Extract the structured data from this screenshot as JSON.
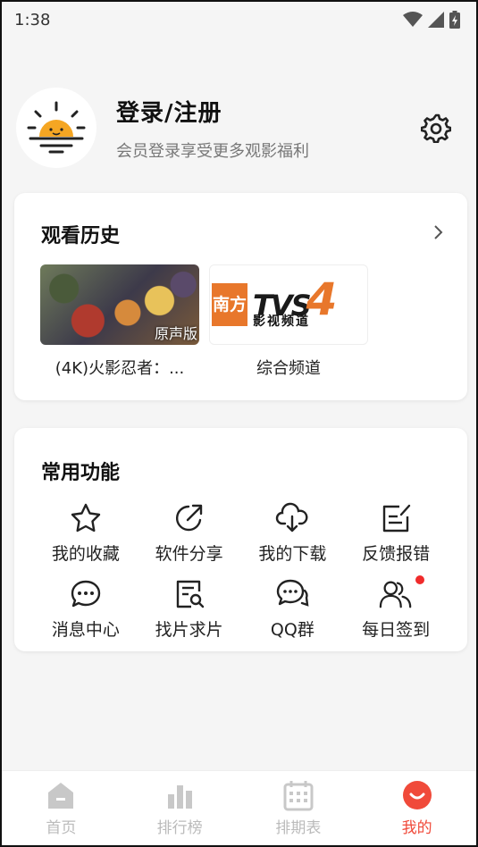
{
  "status_bar": {
    "time": "1:38"
  },
  "profile": {
    "title": "登录/注册",
    "subtitle": "会员登录享受更多观影福利"
  },
  "history": {
    "title": "观看历史",
    "items": [
      {
        "caption": "(4K)火影忍者：...",
        "badge": "原声版"
      },
      {
        "caption": "综合频道",
        "logo_box": "南方",
        "logo_letters": "TVS",
        "logo_num": "4",
        "logo_sub": "影视频道"
      }
    ]
  },
  "features": {
    "title": "常用功能",
    "items": [
      {
        "label": "我的收藏",
        "icon": "star-icon"
      },
      {
        "label": "软件分享",
        "icon": "share-icon"
      },
      {
        "label": "我的下载",
        "icon": "cloud-download-icon"
      },
      {
        "label": "反馈报错",
        "icon": "edit-note-icon"
      },
      {
        "label": "消息中心",
        "icon": "chat-bubble-icon"
      },
      {
        "label": "找片求片",
        "icon": "search-document-icon"
      },
      {
        "label": "QQ群",
        "icon": "group-chat-icon"
      },
      {
        "label": "每日签到",
        "icon": "people-icon",
        "badge_dot": true
      }
    ]
  },
  "tabs": [
    {
      "label": "首页",
      "icon": "home-icon",
      "active": false
    },
    {
      "label": "排行榜",
      "icon": "bar-chart-icon",
      "active": false
    },
    {
      "label": "排期表",
      "icon": "calendar-icon",
      "active": false
    },
    {
      "label": "我的",
      "icon": "smile-icon",
      "active": true
    }
  ],
  "colors": {
    "accent": "#f04a3a",
    "logo_orange": "#e8772b",
    "sun": "#f5a623"
  }
}
